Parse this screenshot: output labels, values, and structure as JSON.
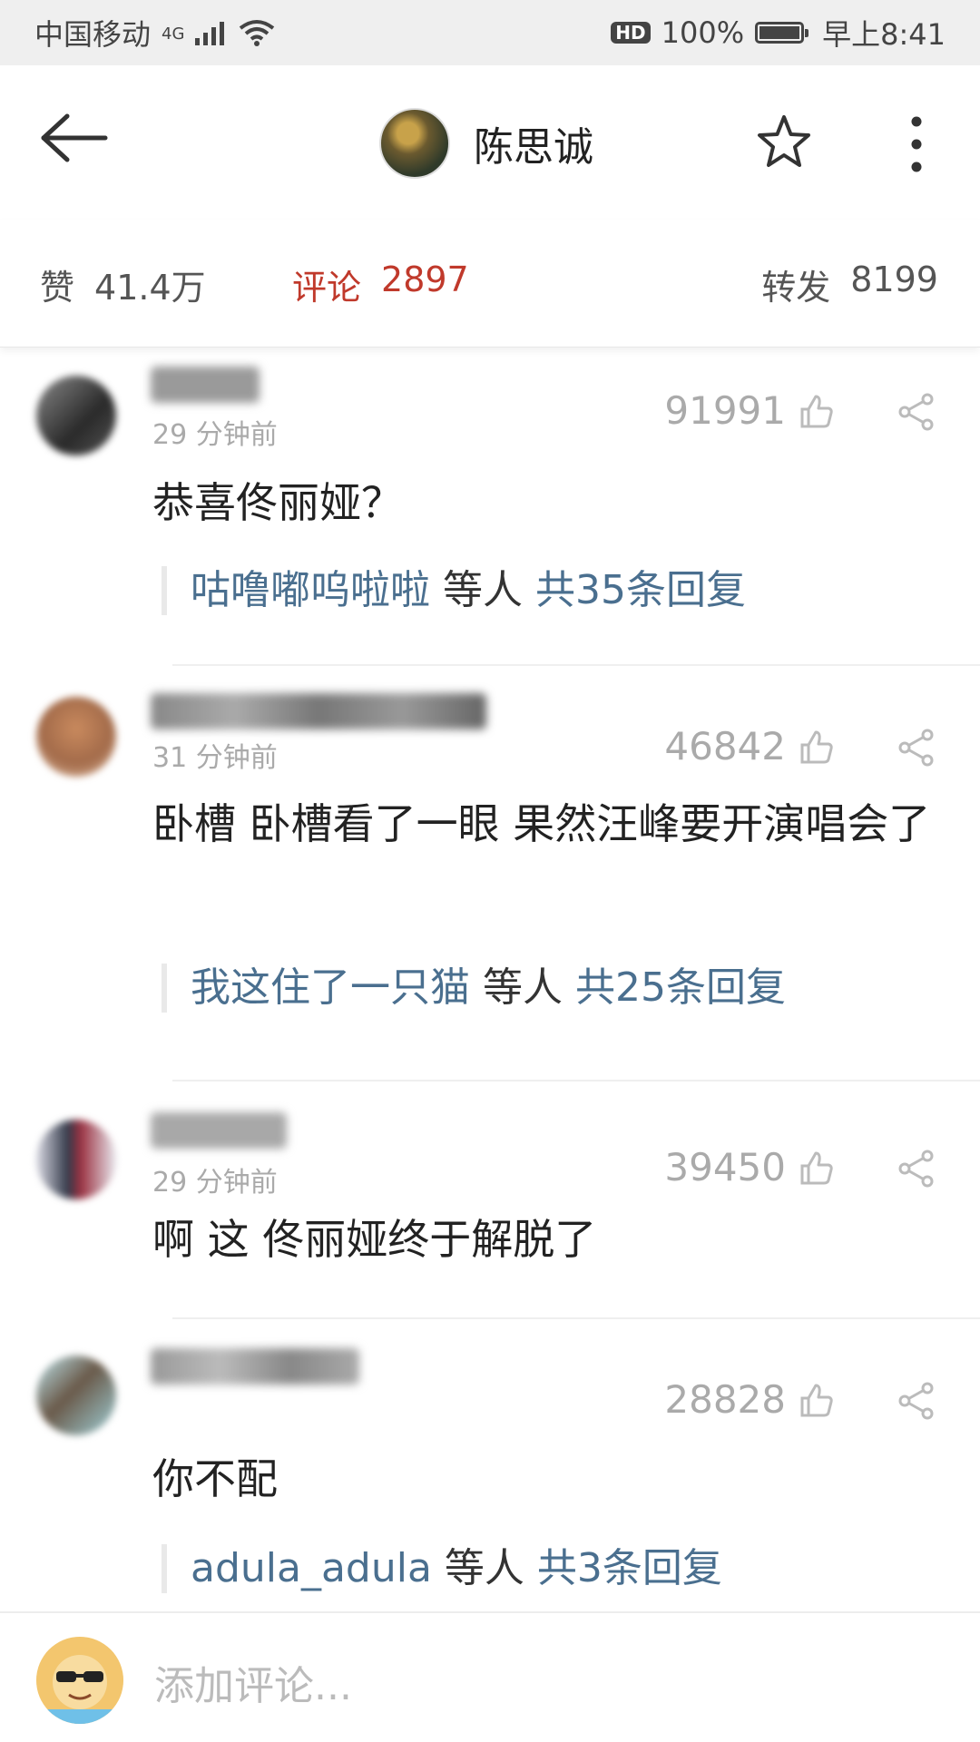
{
  "status_bar": {
    "carrier": "中国移动",
    "network": "4G",
    "hd": "HD",
    "battery": "100%",
    "time": "早上8:41"
  },
  "header": {
    "title": "陈思诚"
  },
  "tabs": {
    "likes_label": "赞",
    "likes_count": "41.4万",
    "comments_label": "评论",
    "comments_count": "2897",
    "reposts_label": "转发",
    "reposts_count": "8199",
    "active_color": "#c0392b"
  },
  "comments": [
    {
      "time": "29 分钟前",
      "likes": "91991",
      "text": "恭喜佟丽娅？",
      "reply_names": "咕噜嘟呜啦啦",
      "reply_mid": " 等人 ",
      "reply_count": "共35条回复"
    },
    {
      "time": "31 分钟前",
      "likes": "46842",
      "text": "卧槽 卧槽看了一眼 果然汪峰要开演唱会了",
      "reply_names": "我这住了一只猫",
      "reply_mid": " 等人 ",
      "reply_count": "共25条回复"
    },
    {
      "time": "29 分钟前",
      "likes": "39450",
      "text": "啊 这 佟丽娅终于解脱了"
    },
    {
      "likes": "28828",
      "text": "你不配",
      "reply_names": "adula_adula",
      "reply_mid": " 等人 ",
      "reply_count": "共3条回复"
    }
  ],
  "input": {
    "placeholder": "添加评论..."
  }
}
